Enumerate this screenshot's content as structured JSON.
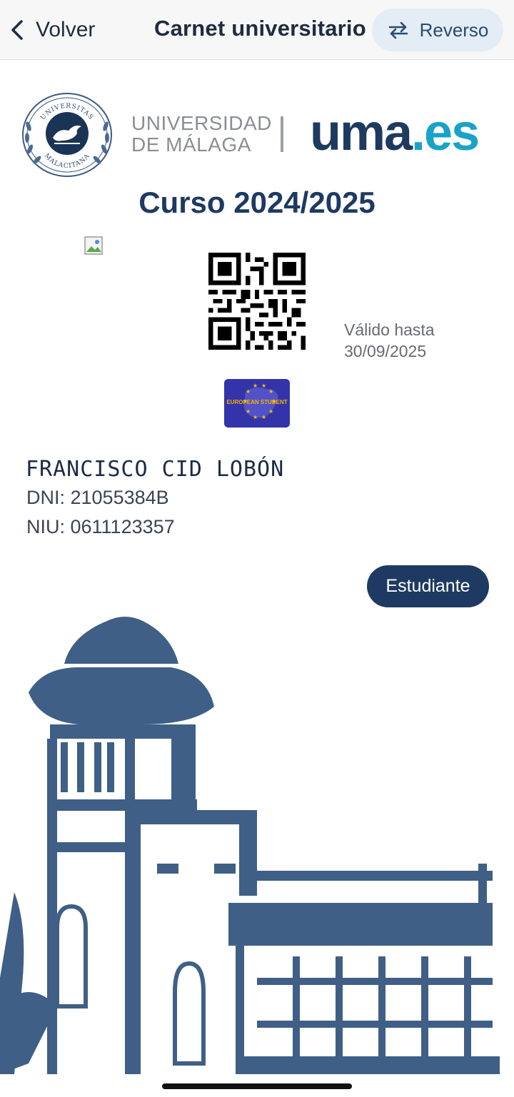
{
  "header": {
    "back_label": "Volver",
    "title": "Carnet universitario",
    "flip_label": "Reverso"
  },
  "logos": {
    "seal_text_top": "UNIVERSITAS",
    "seal_text_bottom": "MALACITANA",
    "university_line1": "UNIVERSIDAD",
    "university_line2": "DE MÁLAGA",
    "uma_part1": "uma",
    "uma_part2": ".es"
  },
  "card": {
    "course": "Curso 2024/2025",
    "valid_label": "Válido hasta",
    "valid_date": "30/09/2025",
    "esc_label": "EUROPEAN STUDENT",
    "holder_name": "FRANCISCO CID LOBÓN",
    "dni": "DNI: 21055384B",
    "niu": "NIU: 0611123357",
    "role": "Estudiante"
  },
  "colors": {
    "primary": "#1e3a62",
    "uma_blue": "#1aa3c8",
    "building": "#3f5f86",
    "flip_bg": "#e4edf5"
  },
  "icons": {
    "back": "chevron-left-icon",
    "flip": "swap-arrows-icon",
    "broken_image": "broken-image-icon"
  }
}
